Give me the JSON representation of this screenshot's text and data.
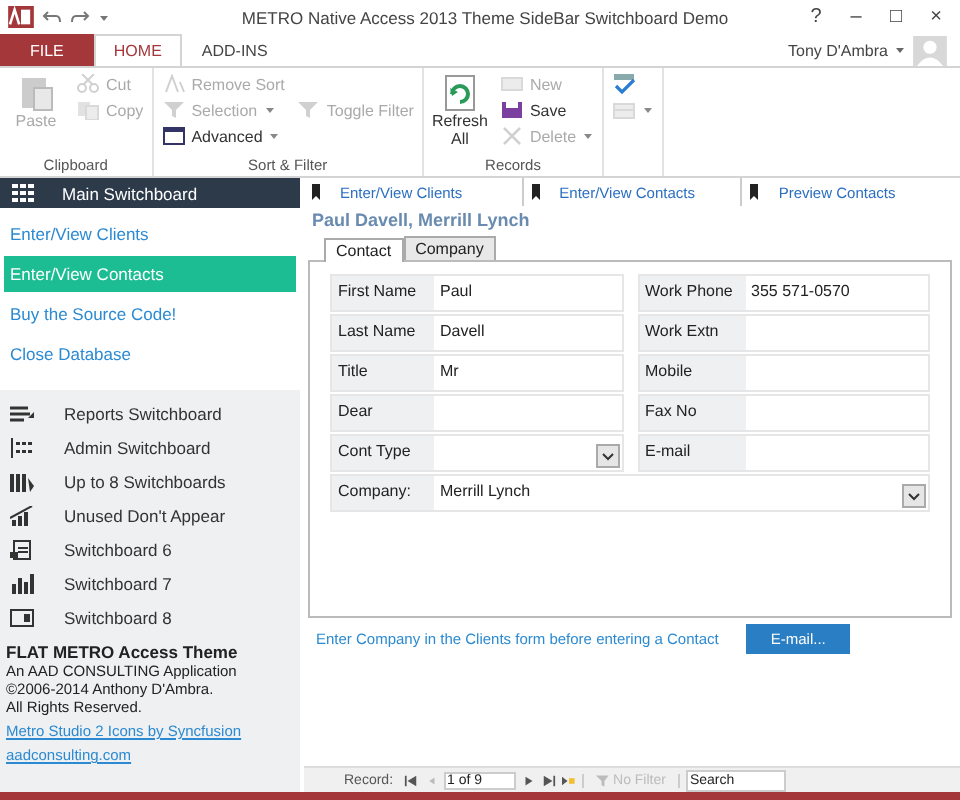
{
  "window": {
    "title": "METRO Native Access 2013 Theme SideBar Switchboard Demo",
    "buttons": [
      "?",
      "–",
      "□",
      "×"
    ],
    "user": "Tony D'Ambra"
  },
  "ribbon_tabs": [
    {
      "label": "FILE",
      "kind": "file",
      "selected": false
    },
    {
      "label": "HOME",
      "kind": "tab",
      "selected": true
    },
    {
      "label": "ADD-INS",
      "kind": "tab",
      "selected": false
    }
  ],
  "ribbon_groups": [
    {
      "label": "Clipboard",
      "large": {
        "label": "Paste",
        "kind": "paste",
        "disabled": true
      },
      "commands": [
        {
          "label": "Cut",
          "kind": "cut",
          "disabled": true,
          "dropdown": false
        },
        {
          "label": "Copy",
          "kind": "copy",
          "disabled": true,
          "dropdown": false
        }
      ]
    },
    {
      "label": "Sort & Filter",
      "commands": [
        {
          "label": "Remove Sort",
          "kind": "sort",
          "disabled": true,
          "dropdown": false
        },
        {
          "label": "Selection",
          "kind": "filter",
          "disabled": true,
          "dropdown": true
        },
        {
          "label": "Advanced",
          "kind": "advanced",
          "disabled": false,
          "dropdown": true
        }
      ],
      "extra": {
        "label": "Toggle Filter",
        "kind": "filter",
        "disabled": true
      }
    },
    {
      "label": "Records",
      "large": {
        "label": "Refresh All",
        "kind": "refresh",
        "disabled": false
      },
      "commands": [
        {
          "label": "New",
          "kind": "new",
          "disabled": true,
          "dropdown": false
        },
        {
          "label": "Save",
          "kind": "save",
          "disabled": false,
          "dropdown": false
        },
        {
          "label": "Delete",
          "kind": "delete",
          "disabled": true,
          "dropdown": true
        }
      ]
    },
    {
      "commands": [
        {
          "kind": "spelling",
          "disabled": false,
          "dropdown": false
        },
        {
          "kind": "more",
          "disabled": true,
          "dropdown": true
        }
      ]
    }
  ],
  "sidebar": {
    "header": "Main Switchboard",
    "links": [
      {
        "label": "Enter/View Clients",
        "selected": false
      },
      {
        "label": "Enter/View Contacts",
        "selected": true
      },
      {
        "label": "Buy the Source Code!",
        "selected": false
      },
      {
        "label": "Close Database",
        "selected": false
      }
    ],
    "switchboards": [
      {
        "label": "Reports Switchboard",
        "kind": "report"
      },
      {
        "label": "Admin Switchboard",
        "kind": "admin"
      },
      {
        "label": "Up to 8 Switchboards",
        "kind": "books"
      },
      {
        "label": "Unused Don't Appear",
        "kind": "chart"
      },
      {
        "label": "Switchboard 6",
        "kind": "form"
      },
      {
        "label": "Switchboard 7",
        "kind": "bars"
      },
      {
        "label": "Switchboard 8",
        "kind": "panel"
      }
    ],
    "footer": {
      "title": "FLAT METRO Access Theme",
      "lines": [
        "An AAD CONSULTING Application",
        "©2006-2014 Anthony D'Ambra.",
        "All Rights Reserved."
      ],
      "links": [
        "Metro Studio 2 Icons by Syncfusion",
        "aadconsulting.com"
      ]
    }
  },
  "nav_buttons": [
    "Enter/View Clients",
    "Enter/View Contacts",
    "Preview Contacts"
  ],
  "record_title": "Paul Davell, Merrill Lynch",
  "form_tabs": [
    {
      "label": "Contact",
      "selected": true
    },
    {
      "label": "Company",
      "selected": false
    }
  ],
  "fields_left": [
    {
      "label": "First Name",
      "value": "Paul",
      "kind": "text"
    },
    {
      "label": "Last Name",
      "value": "Davell",
      "kind": "text"
    },
    {
      "label": "Title",
      "value": "Mr",
      "kind": "text"
    },
    {
      "label": "Dear",
      "kind": "text"
    },
    {
      "label": "Cont Type",
      "kind": "combo"
    }
  ],
  "fields_right": [
    {
      "label": "Work Phone",
      "value": "355 571-0570",
      "kind": "text"
    },
    {
      "label": "Work Extn",
      "kind": "text"
    },
    {
      "label": "Mobile",
      "kind": "text"
    },
    {
      "label": "Fax No",
      "kind": "text"
    },
    {
      "label": "E-mail",
      "kind": "text"
    }
  ],
  "company_field": {
    "label": "Company:",
    "value": "Merrill Lynch",
    "kind": "combo"
  },
  "message": "Enter Company in the Clients form before entering a Contact",
  "email_button": "E-mail...",
  "record_nav": {
    "label": "Record:",
    "position": "1 of 9",
    "filter": "No Filter",
    "search_placeholder": "Search"
  }
}
